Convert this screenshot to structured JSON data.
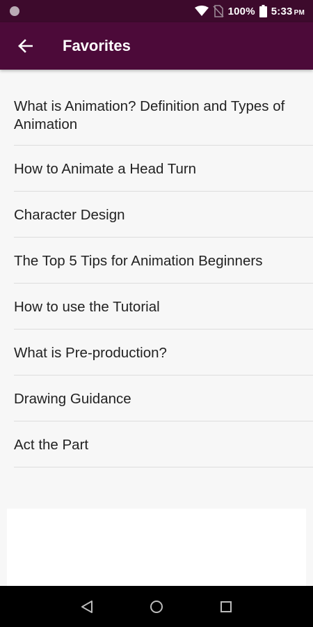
{
  "status_bar": {
    "battery": "100%",
    "time": "5:33",
    "time_suffix": "PM"
  },
  "app_bar": {
    "title": "Favorites"
  },
  "favorites": [
    "What is Animation? Definition and Types of Animation",
    "How to Animate a Head Turn",
    "Character Design",
    "The Top 5 Tips for Animation Beginners",
    "How to use the Tutorial",
    "What is Pre-production?",
    "Drawing Guidance",
    "Act the Part"
  ],
  "colors": {
    "app_bar": "#4c0a39",
    "status_bar": "#3d0a2c",
    "background": "#f7f7f7"
  }
}
